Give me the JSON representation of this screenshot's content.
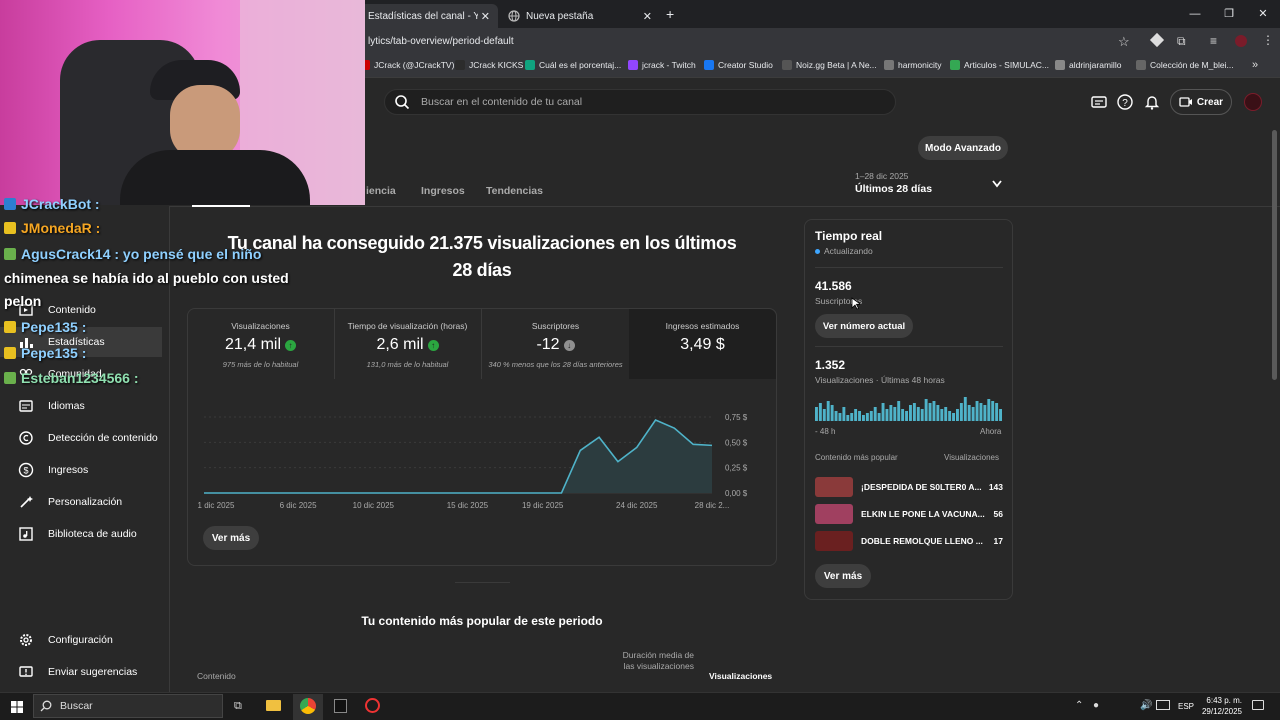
{
  "browser": {
    "tabs": [
      {
        "label": "Estadísticas del canal - YouTube",
        "close": "✕"
      },
      {
        "label": "Nueva pestaña",
        "close": "✕"
      }
    ],
    "new_tab": "+",
    "url": "lytics/tab-overview/period-default",
    "bookmarks": [
      {
        "label": "JCrack (@JCrackTV)...",
        "color": "#cc0000"
      },
      {
        "label": "JCrack KICKS",
        "color": "#2c2c2c"
      },
      {
        "label": "Cuál es el porcentaj...",
        "color": "#10a37f"
      },
      {
        "label": "jcrack - Twitch",
        "color": "#9146ff"
      },
      {
        "label": "Creator Studio",
        "color": "#1877f2"
      },
      {
        "label": "Noiz.gg Beta | A Ne...",
        "color": "#555555"
      },
      {
        "label": "harmonicity",
        "color": "#777777"
      },
      {
        "label": "Articulos - SIMULAC...",
        "color": "#34a853"
      },
      {
        "label": "aldrinjaramillo",
        "color": "#888888"
      },
      {
        "label": "Colección de M_blei...",
        "color": "#666666"
      }
    ],
    "bookmarks_more": "»"
  },
  "studio": {
    "search_placeholder": "Buscar en el contenido de tu canal",
    "create_label": "Crear",
    "advanced_mode": "Modo Avanzado",
    "tabs": [
      "iencia",
      "Ingresos",
      "Tendencias"
    ],
    "range_sub": "1–28 dic 2025",
    "range": "Últimos 28 días",
    "headline": "Tu canal ha conseguido 21.375 visualizaciones en los últimos 28 días",
    "metrics": [
      {
        "label": "Visualizaciones",
        "value": "21,4 mil",
        "trend": "up",
        "sub": "975 más de lo habitual"
      },
      {
        "label": "Tiempo de visualización (horas)",
        "value": "2,6 mil",
        "trend": "up",
        "sub": "131,0 más de lo habitual"
      },
      {
        "label": "Suscriptores",
        "value": "-12",
        "trend": "down",
        "sub": "340 % menos que los 28 días anteriores"
      },
      {
        "label": "Ingresos estimados",
        "value": "3,49 $",
        "trend": "none",
        "sub": ""
      }
    ],
    "see_more": "Ver más",
    "top_content_title": "Tu contenido más popular de este periodo",
    "table_headers": {
      "content": "Contenido",
      "avg_duration": "Duración media de las visualizaciones",
      "views": "Visualizaciones"
    },
    "sidebar": [
      {
        "label": "Contenido",
        "icon": "content-icon"
      },
      {
        "label": "Estadísticas",
        "icon": "analytics-icon"
      },
      {
        "label": "Comunidad",
        "icon": "community-icon"
      },
      {
        "label": "Idiomas",
        "icon": "subtitles-icon"
      },
      {
        "label": "Detección de contenido",
        "icon": "copyright-icon"
      },
      {
        "label": "Ingresos",
        "icon": "dollar-icon"
      },
      {
        "label": "Personalización",
        "icon": "wand-icon"
      },
      {
        "label": "Biblioteca de audio",
        "icon": "audio-library-icon"
      },
      {
        "label": "Configuración",
        "icon": "gear-icon"
      },
      {
        "label": "Enviar sugerencias",
        "icon": "feedback-icon"
      }
    ]
  },
  "chart_data": {
    "type": "area",
    "x_ticks": [
      "1 dic 2025",
      "6 dic 2025",
      "10 dic 2025",
      "15 dic 2025",
      "19 dic 2025",
      "24 dic 2025",
      "28 dic 2..."
    ],
    "y_ticks": [
      "0,75 $",
      "0,50 $",
      "0,25 $",
      "0,00 $"
    ],
    "ylim": [
      0,
      0.75
    ],
    "x": [
      1,
      2,
      3,
      4,
      5,
      6,
      7,
      8,
      9,
      10,
      11,
      12,
      13,
      14,
      15,
      16,
      17,
      18,
      19,
      20,
      21,
      22,
      23,
      24,
      25,
      26,
      27,
      28
    ],
    "values": [
      0,
      0,
      0,
      0,
      0,
      0,
      0,
      0,
      0,
      0,
      0,
      0,
      0,
      0,
      0,
      0,
      0,
      0,
      0,
      0,
      0.42,
      0.55,
      0.31,
      0.45,
      0.72,
      0.64,
      0.48,
      0.47
    ],
    "color": "#4fb3c9"
  },
  "realtime": {
    "title": "Tiempo real",
    "updating": "Actualizando",
    "subscribers": "41.586",
    "subscribers_label": "Suscriptores",
    "see_current": "Ver número actual",
    "views": "1.352",
    "views_label": "Visualizaciones · Últimas 48 horas",
    "bars": [
      7,
      9,
      6,
      10,
      8,
      5,
      4,
      7,
      3,
      4,
      6,
      5,
      3,
      4,
      5,
      7,
      4,
      9,
      6,
      8,
      7,
      10,
      6,
      5,
      8,
      9,
      7,
      6,
      11,
      9,
      10,
      8,
      6,
      7,
      5,
      4,
      6,
      9,
      12,
      8,
      7,
      10,
      9,
      8,
      11,
      10,
      9,
      6
    ],
    "axis_left": "- 48 h",
    "axis_right": "Ahora",
    "popular_label": "Contenido más popular",
    "popular_views_label": "Visualizaciones",
    "popular": [
      {
        "title": "¡DESPEDIDA DE S0LTER0 A...",
        "views": "143",
        "color": "#8a3a3a"
      },
      {
        "title": "ELKIN LE PONE LA VACUNA...",
        "views": "56",
        "color": "#a04060"
      },
      {
        "title": "DOBLE REMOLQUE LLENO ...",
        "views": "17",
        "color": "#6a2020"
      }
    ],
    "see_more": "Ver más",
    "accent": "#3ea6ff"
  },
  "chat": [
    {
      "text": "JCrackBot :",
      "color": "#8fd0ff",
      "icon_color": "#2d7fd1"
    },
    {
      "text": "JMonedaR :",
      "color": "#f5a623",
      "icon_color": "#e8c020"
    },
    {
      "text": "AgusCrack14 : yo pensé que el niño",
      "color": "#8fd0ff",
      "icon_color": "#6ab04c"
    },
    {
      "text": "chimenea se había ido al pueblo con usted",
      "color": "#ffffff",
      "icon_color": ""
    },
    {
      "text": "pelon",
      "color": "#ffffff",
      "icon_color": ""
    },
    {
      "text": "Pepe135 :",
      "color": "#8fd0ff",
      "icon_color": "#e8c020"
    },
    {
      "text": "Pepe135 :",
      "color": "#8fd0ff",
      "icon_color": "#e8c020"
    },
    {
      "text": "Esteban1234566 :",
      "color": "#8fe0b0",
      "icon_color": "#6ab04c"
    }
  ],
  "taskbar": {
    "search_placeholder": "Buscar",
    "lang": "ESP",
    "time": "6:43 p. m.",
    "date": "29/12/2025"
  }
}
